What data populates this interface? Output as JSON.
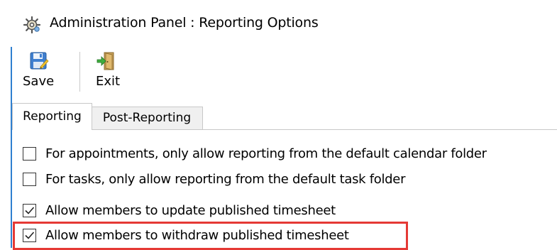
{
  "window": {
    "title": "Administration Panel : Reporting Options",
    "icon": "gear-icon"
  },
  "toolbar": {
    "save_label": "Save",
    "save_icon": "save-disk-icon",
    "exit_label": "Exit",
    "exit_icon": "exit-door-icon"
  },
  "tabs": [
    {
      "label": "Reporting",
      "active": true
    },
    {
      "label": "Post-Reporting",
      "active": false
    }
  ],
  "options": [
    {
      "label": "For appointments, only allow reporting from the default calendar folder",
      "checked": false
    },
    {
      "label": "For tasks, only allow reporting from the default task folder",
      "checked": false
    },
    {
      "label": "Allow members to update published timesheet",
      "checked": true
    },
    {
      "label": "Allow members to withdraw published timesheet",
      "checked": true,
      "highlighted": true
    }
  ],
  "colors": {
    "highlight": "#e53935",
    "accent": "#2f7fd0"
  }
}
